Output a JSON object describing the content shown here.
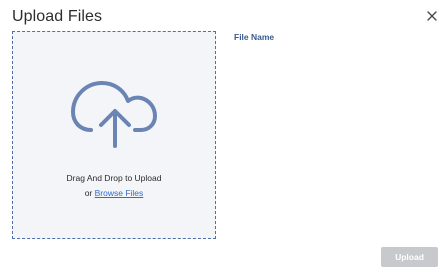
{
  "dialog": {
    "title": "Upload Files",
    "close_icon": "close-icon"
  },
  "dropzone": {
    "icon": "cloud-upload-icon",
    "instruction": "Drag And Drop to Upload",
    "or_text": "or ",
    "browse_label": "Browse Files"
  },
  "file_list": {
    "column_header": "File Name"
  },
  "footer": {
    "upload_label": "Upload",
    "upload_enabled": false
  },
  "colors": {
    "accent": "#4f6fa8",
    "link": "#2f6fc6",
    "icon": "#6a84b4",
    "dropzone_bg": "#f4f5f9",
    "disabled_button": "#c7c9cd"
  }
}
